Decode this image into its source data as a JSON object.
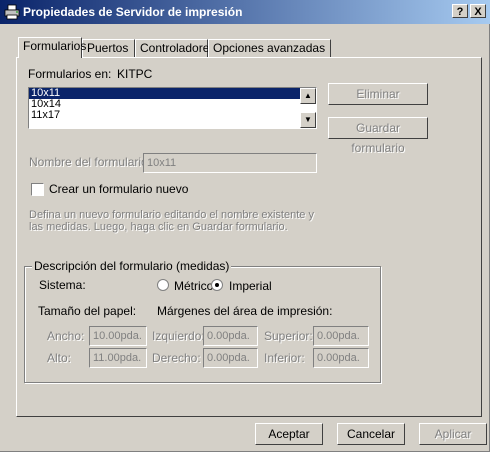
{
  "window": {
    "title": "Propiedades de Servidor de impresión",
    "help_glyph": "?",
    "close_glyph": "X"
  },
  "tabs": [
    {
      "label": "Formularios"
    },
    {
      "label": "Puertos"
    },
    {
      "label": "Controladores"
    },
    {
      "label": "Opciones avanzadas"
    }
  ],
  "forms": {
    "on_label": "Formularios en:",
    "server": "KITPC",
    "list": [
      "10x11",
      "10x14",
      "11x17"
    ],
    "selected": "10x11",
    "delete_button": "Eliminar",
    "save_button": "Guardar formulario",
    "name_label": "Nombre del formulario:",
    "name_value": "10x11",
    "create_new_label": "Crear un formulario nuevo",
    "create_new_checked": false,
    "help_text_1": "Defina un nuevo formulario editando el nombre existente y",
    "help_text_2": "las medidas. Luego, haga clic en Guardar formulario."
  },
  "description": {
    "group_title": "Descripción del formulario (medidas)",
    "system_label": "Sistema:",
    "metric_label": "Métrico",
    "imperial_label": "Imperial",
    "selected_system": "Imperial",
    "paper_size_label": "Tamaño del papel:",
    "margins_label": "Márgenes del área de impresión:",
    "width_label": "Ancho:",
    "width_value": "10.00pda.",
    "height_label": "Alto:",
    "height_value": "11.00pda.",
    "left_label": "Izquierdo:",
    "left_value": "0.00pda.",
    "right_label": "Derecho:",
    "right_value": "0.00pda.",
    "top_label": "Superior:",
    "top_value": "0.00pda.",
    "bottom_label": "Inferior:",
    "bottom_value": "0.00pda."
  },
  "buttons": {
    "ok": "Aceptar",
    "cancel": "Cancelar",
    "apply": "Aplicar"
  }
}
